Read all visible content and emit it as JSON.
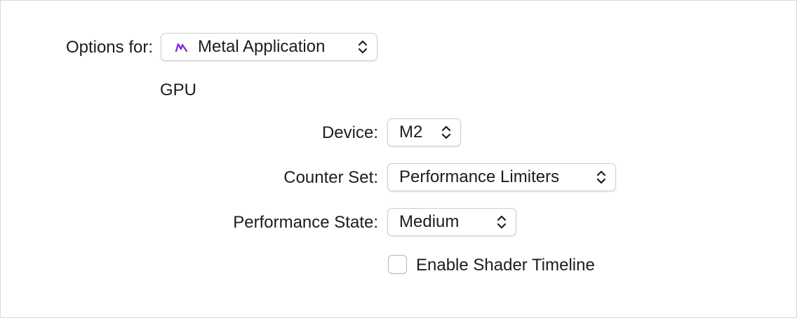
{
  "options_for": {
    "label": "Options for:",
    "selected": "Metal Application",
    "icon": "metal-app-icon",
    "icon_color": "#8a2be2"
  },
  "gpu": {
    "section_title": "GPU",
    "device": {
      "label": "Device:",
      "selected": "M2"
    },
    "counter_set": {
      "label": "Counter Set:",
      "selected": "Performance Limiters"
    },
    "performance_state": {
      "label": "Performance State:",
      "selected": "Medium"
    },
    "shader_timeline": {
      "label": "Enable Shader Timeline",
      "checked": false
    }
  }
}
